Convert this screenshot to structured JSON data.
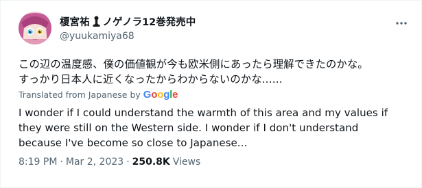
{
  "author": {
    "name_prefix": "榎宮祐",
    "name_suffix": "ノゲノラ12巻発売中",
    "handle": "@yuukamiya68"
  },
  "tweet": {
    "original_lines": [
      "この辺の温度感、僕の価値観が今も欧米側にあったら理解できたのかな。",
      "すっかり日本人に近くなったからわからないのかな......"
    ],
    "translated_label": "Translated from Japanese by",
    "translator_brand": "Google",
    "translation_lines": [
      "I wonder if I could understand the warmth of this area and my values if",
      "they were still on the Western side. I wonder if I don't understand",
      "because I've become so close to Japanese..."
    ]
  },
  "meta": {
    "time": "8:19 PM",
    "separator": "·",
    "date": "Mar 2, 2023",
    "views_count": "250.8K",
    "views_label": "Views"
  },
  "icons": {
    "more": "more-horizontal-icon",
    "pawn": "chess-pawn-icon"
  },
  "colors": {
    "text_primary": "#0f1419",
    "text_secondary": "#536471",
    "google_blue": "#4285F4",
    "google_red": "#EA4335",
    "google_yellow": "#FBBC05",
    "google_green": "#34A853"
  }
}
